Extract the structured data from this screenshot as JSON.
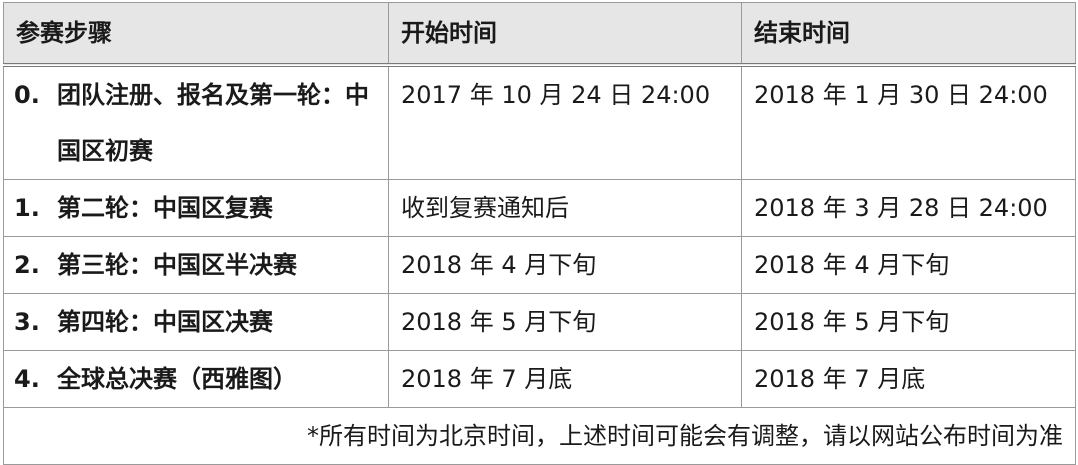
{
  "table": {
    "headers": {
      "step": "参赛步骤",
      "start": "开始时间",
      "end": "结束时间"
    },
    "rows": [
      {
        "num": "0.",
        "step": "团队注册、报名及第一轮：中国区初赛",
        "start": "2017 年 10 月 24 日 24:00",
        "end": "2018 年 1 月 30 日 24:00"
      },
      {
        "num": "1.",
        "step": "第二轮：中国区复赛",
        "start": "收到复赛通知后",
        "end": "2018 年 3 月 28 日 24:00"
      },
      {
        "num": "2.",
        "step": "第三轮：中国区半决赛",
        "start": "2018 年 4 月下旬",
        "end": "2018 年 4 月下旬"
      },
      {
        "num": "3.",
        "step": "第四轮：中国区决赛",
        "start": "2018 年 5 月下旬",
        "end": "2018 年 5 月下旬"
      },
      {
        "num": "4.",
        "step": "全球总决赛（西雅图）",
        "start": "2018 年 7 月底",
        "end": "2018 年 7 月底"
      }
    ],
    "footnote": "*所有时间为北京时间，上述时间可能会有调整，请以网站公布时间为准"
  }
}
